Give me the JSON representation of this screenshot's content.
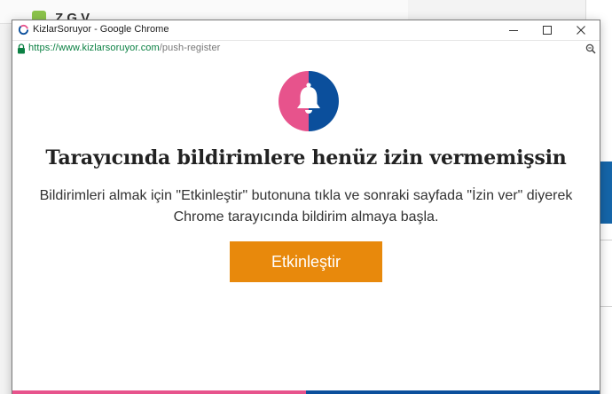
{
  "background": {
    "partial_text": "Z                                   G     V         "
  },
  "window": {
    "title": "KizlarSoruyor - Google Chrome",
    "controls": {
      "minimize": "—",
      "maximize": "☐",
      "close": "✕"
    }
  },
  "address_bar": {
    "url_scheme_host": "https://www.kizlarsoruyor.com",
    "url_path": "/push-register"
  },
  "content": {
    "heading": "Tarayıcında bildirimlere henüz izin vermemişsin",
    "description": "Bildirimleri almak için \"Etkinleştir\" butonuna tıkla ve sonraki sayfada \"İzin ver\" diyerek Chrome tarayıcında bildirim almaya başla.",
    "button_label": "Etkinleştir"
  },
  "icons": {
    "favicon": "spinner-ring-icon",
    "lock": "lock-icon",
    "zoom": "zoom-magnifier-icon",
    "bell": "bell-icon"
  },
  "colors": {
    "brand_pink": "#e7538c",
    "brand_blue": "#0b4f9c",
    "button_orange": "#e8890c",
    "secure_green": "#0b8043"
  }
}
